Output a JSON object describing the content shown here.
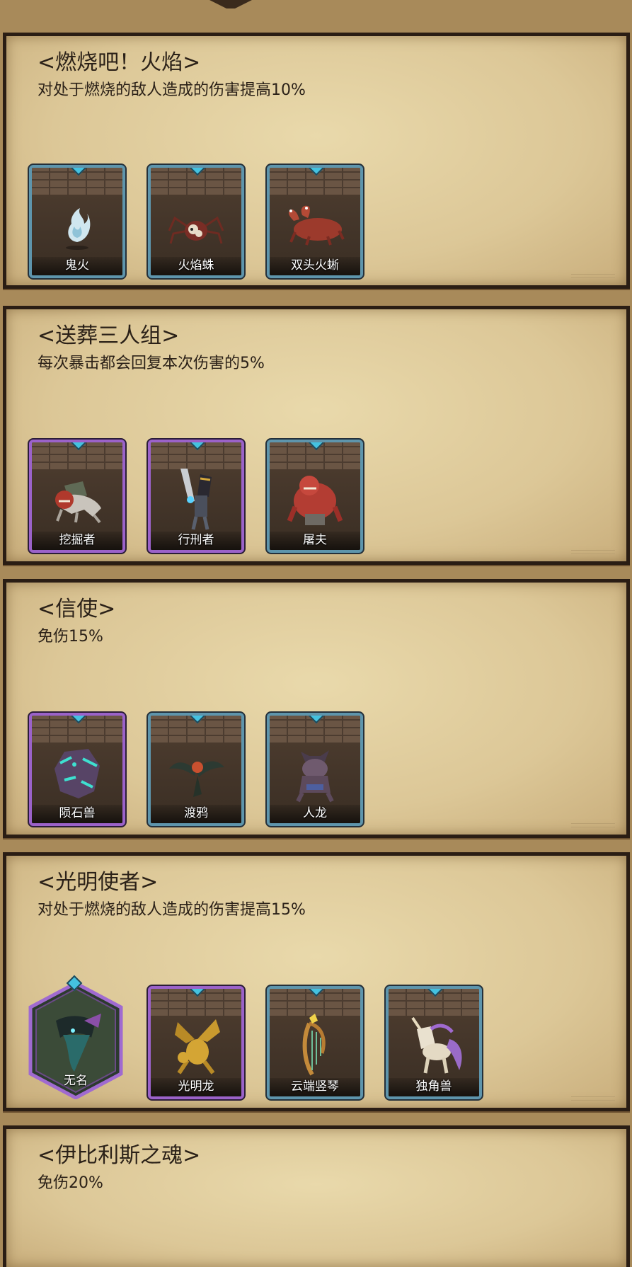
{
  "sets": [
    {
      "title": "<燃烧吧！火焰>",
      "description": "对处于燃烧的敌人造成的伤害提高10%",
      "units": [
        {
          "name": "鬼火",
          "frame": "blue",
          "icon": "ghost-fire-icon"
        },
        {
          "name": "火焰蛛",
          "frame": "blue",
          "icon": "fire-spider-icon"
        },
        {
          "name": "双头火蜥",
          "frame": "blue",
          "icon": "two-headed-salamander-icon"
        }
      ]
    },
    {
      "title": "<送葬三人组>",
      "description": "每次暴击都会回复本次伤害的5%",
      "units": [
        {
          "name": "挖掘者",
          "frame": "purple",
          "icon": "digger-icon"
        },
        {
          "name": "行刑者",
          "frame": "purple",
          "icon": "executioner-icon"
        },
        {
          "name": "屠夫",
          "frame": "blue",
          "icon": "butcher-icon"
        }
      ]
    },
    {
      "title": "<信使>",
      "description": "免伤15%",
      "units": [
        {
          "name": "陨石兽",
          "frame": "purple",
          "icon": "meteor-beast-icon"
        },
        {
          "name": "渡鸦",
          "frame": "blue",
          "icon": "raven-icon"
        },
        {
          "name": "人龙",
          "frame": "blue",
          "icon": "dragonman-icon"
        }
      ]
    },
    {
      "title": "<光明使者>",
      "description": "对处于燃烧的敌人造成的伤害提高15%",
      "units": [
        {
          "name": "无名",
          "frame": "hex",
          "icon": "nameless-icon"
        },
        {
          "name": "光明龙",
          "frame": "purple",
          "icon": "light-dragon-icon"
        },
        {
          "name": "云端竖琴",
          "frame": "blue",
          "icon": "cloud-harp-icon"
        },
        {
          "name": "独角兽",
          "frame": "blue",
          "icon": "unicorn-icon"
        }
      ]
    },
    {
      "title": "<伊比利斯之魂>",
      "description": "免伤20%",
      "units": []
    }
  ],
  "colors": {
    "parchment": "#e2cf9f",
    "border_dark": "#2a1d14",
    "frame_blue": "#5e95ac",
    "frame_purple": "#9b62c9",
    "gem": "#44c2e0",
    "text": "#2b2118"
  }
}
